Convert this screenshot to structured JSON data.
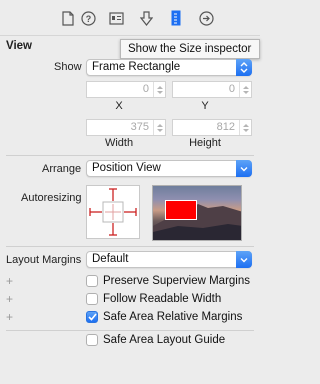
{
  "toolbar": {
    "icons": [
      "file-inspector-icon",
      "quick-help-icon",
      "identity-inspector-icon",
      "attributes-inspector-icon",
      "size-inspector-icon",
      "connections-inspector-icon"
    ]
  },
  "tooltip": "Show the Size inspector",
  "view": {
    "title": "View",
    "show_label": "Show",
    "show_value": "Frame Rectangle",
    "x_value": "0",
    "y_value": "0",
    "x_label": "X",
    "y_label": "Y",
    "width_value": "375",
    "height_value": "812",
    "width_label": "Width",
    "height_label": "Height"
  },
  "arrange": {
    "label": "Arrange",
    "value": "Position View"
  },
  "autoresizing": {
    "label": "Autoresizing"
  },
  "layout_margins": {
    "label": "Layout Margins",
    "value": "Default"
  },
  "checkboxes": [
    {
      "label": "Preserve Superview Margins",
      "checked": false,
      "plus": "+"
    },
    {
      "label": "Follow Readable Width",
      "checked": false,
      "plus": "+"
    },
    {
      "label": "Safe Area Relative Margins",
      "checked": true,
      "plus": "+"
    },
    {
      "label": "Safe Area Layout Guide",
      "checked": false,
      "plus": ""
    }
  ],
  "colors": {
    "accent": "#1d6ff2",
    "autoresize_strut": "#cc2222",
    "preview_rect": "#ff0000"
  }
}
